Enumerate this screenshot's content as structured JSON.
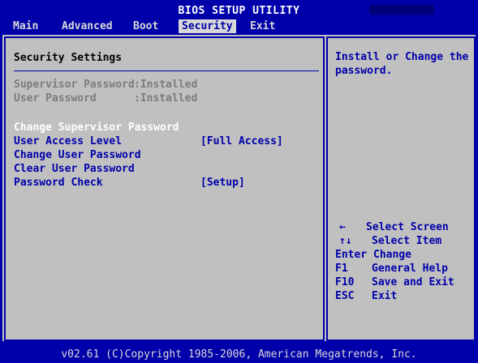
{
  "header": {
    "title": "BIOS SETUP UTILITY",
    "tabs": [
      "Main",
      "Advanced",
      "Boot",
      "Security",
      "Exit"
    ],
    "selected_tab": "Security"
  },
  "left": {
    "section_title": "Security Settings",
    "status": [
      {
        "label": "Supervisor Password",
        "value": ":Installed"
      },
      {
        "label": "User Password",
        "value": ":Installed"
      }
    ],
    "items": [
      {
        "label": "Change Supervisor Password",
        "value": ""
      },
      {
        "label": "User Access Level",
        "value": "[Full Access]"
      },
      {
        "label": "Change User Password",
        "value": ""
      },
      {
        "label": "Clear User Password",
        "value": ""
      },
      {
        "label": "Password Check",
        "value": "[Setup]"
      }
    ],
    "selected_item": "Change Supervisor Password"
  },
  "right": {
    "help_text": "Install or Change the password.",
    "keys": [
      {
        "key": "←",
        "desc": "Select Screen"
      },
      {
        "key": "↑↓",
        "desc": "Select Item"
      },
      {
        "key": "Enter",
        "desc": "Change"
      },
      {
        "key": "F1",
        "desc": "General Help"
      },
      {
        "key": "F10",
        "desc": "Save and Exit"
      },
      {
        "key": "ESC",
        "desc": "Exit"
      }
    ]
  },
  "footer": {
    "text": "v02.61 (C)Copyright 1985-2006, American Megatrends, Inc."
  },
  "colors": {
    "background": "#0000aa",
    "panel": "#c0c0c0",
    "selected_text": "#ffffff",
    "disabled_text": "#7c7c7c",
    "item_text": "#0000aa"
  }
}
